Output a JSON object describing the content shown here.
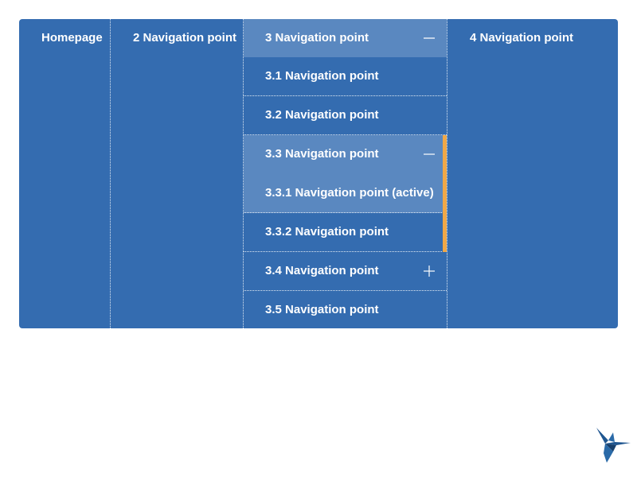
{
  "nav": {
    "home": {
      "label": "Homepage"
    },
    "item2": {
      "label": "2 Navigation point"
    },
    "item3": {
      "label": "3 Navigation point",
      "toggle_icon": "minus-icon",
      "children": [
        {
          "label": "3.1 Navigation point"
        },
        {
          "label": "3.2 Navigation point"
        },
        {
          "label": "3.3 Navigation point",
          "toggle_icon": "minus-icon"
        },
        {
          "label": "3.3.1 Navigation point (active)"
        },
        {
          "label": "3.3.2 Navigation point"
        },
        {
          "label": "3.4 Navigation point",
          "toggle_icon": "plus-icon"
        },
        {
          "label": "3.5 Navigation point"
        }
      ]
    },
    "item4": {
      "label": "4 Navigation point"
    }
  },
  "colors": {
    "panel": "#346cb0",
    "highlight": "#5a88c0",
    "accent": "#f0a848",
    "text": "#ffffff",
    "logo": "#1f5690"
  },
  "logo": {
    "icon": "hummingbird-logo-icon"
  }
}
